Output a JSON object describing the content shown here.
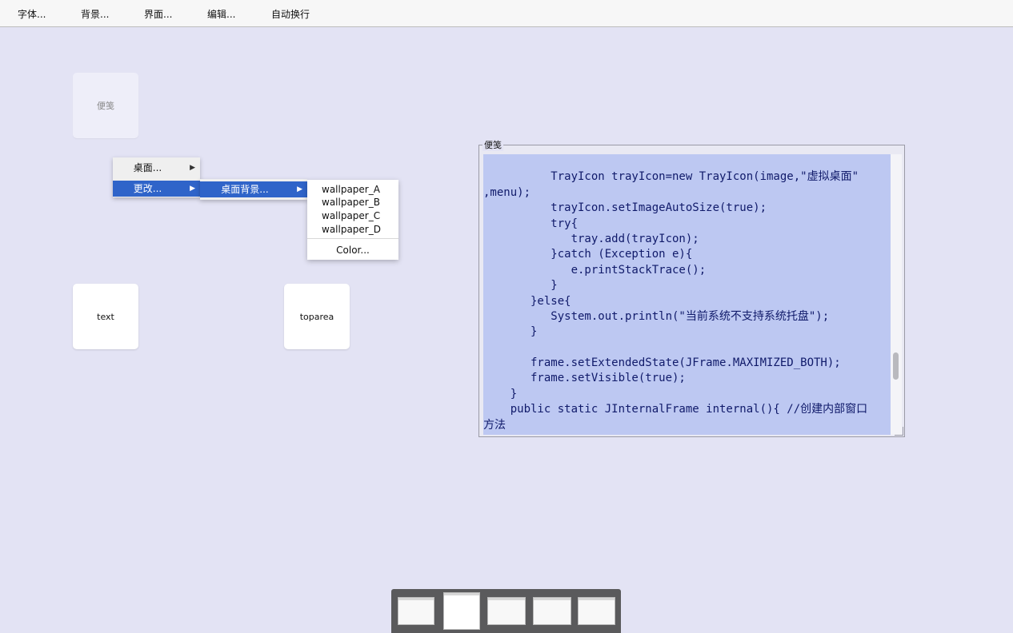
{
  "menubar": {
    "items": [
      "字体...",
      "背景...",
      "界面...",
      "编辑...",
      "自动换行"
    ]
  },
  "desktop": {
    "icons": [
      {
        "label": "便笺"
      },
      {
        "label": "text"
      },
      {
        "label": "toparea"
      }
    ]
  },
  "context_menu": {
    "level1": [
      {
        "label": "桌面..."
      },
      {
        "label": "更改..."
      }
    ],
    "level2": [
      {
        "label": "桌面背景..."
      }
    ],
    "level3": {
      "wallpapers": [
        "wallpaper_A",
        "wallpaper_B",
        "wallpaper_C",
        "wallpaper_D"
      ],
      "color": "Color..."
    },
    "arrow_glyph": "▶"
  },
  "note_window": {
    "title": "便笺",
    "lines": [
      "          TrayIcon trayIcon=new TrayIcon(image,\"虚拟桌面\"",
      ",menu);",
      "          trayIcon.setImageAutoSize(true);",
      "          try{",
      "             tray.add(trayIcon);",
      "          }catch (Exception e){",
      "             e.printStackTrace();",
      "          }",
      "       }else{",
      "          System.out.println(\"当前系统不支持系统托盘\");",
      "       }",
      "",
      "       frame.setExtendedState(JFrame.MAXIMIZED_BOTH);",
      "       frame.setVisible(true);",
      "    }",
      "    public static JInternalFrame internal(){ //创建内部窗口",
      "方法"
    ]
  },
  "colors": {
    "desktop_bg": "#e3e3f4",
    "selection": "#2f64c9",
    "textarea_bg": "#bdc8f2",
    "code_text": "#101a6a"
  }
}
